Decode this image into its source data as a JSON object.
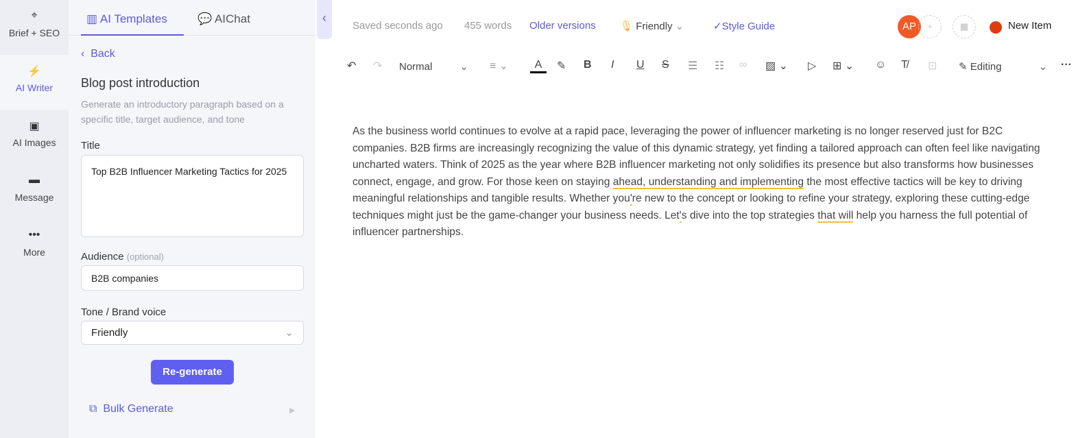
{
  "nav": {
    "items": [
      {
        "label": "Brief + SEO",
        "icon": "crosshair-icon"
      },
      {
        "label": "AI Writer",
        "icon": "lightning-icon"
      },
      {
        "label": "AI Images",
        "icon": "image-icon"
      },
      {
        "label": "Message",
        "icon": "message-icon"
      },
      {
        "label": "More",
        "icon": "more-icon"
      }
    ]
  },
  "panel": {
    "tabs": [
      {
        "label": "AI Templates"
      },
      {
        "label": "AIChat"
      }
    ],
    "back": "Back",
    "template_title": "Blog post introduction",
    "template_desc": "Generate an introductory paragraph based on a specific title, target audience, and tone",
    "title_label": "Title",
    "title_value": "Top B2B Influencer Marketing Tactics for 2025",
    "audience_label": "Audience",
    "audience_optional": "(optional)",
    "audience_value": "B2B companies",
    "tone_label": "Tone / Brand voice",
    "tone_value": "Friendly",
    "regenerate": "Re-generate",
    "bulk_generate": "Bulk Generate"
  },
  "header": {
    "saved": "Saved seconds ago",
    "words": "455 words",
    "older_versions": "Older versions",
    "voice": "Friendly",
    "style_guide": "Style Guide",
    "avatar": "AP",
    "new_item": "New Item",
    "status_color": "#e03a10"
  },
  "toolbar": {
    "style": "Normal",
    "mode": "Editing"
  },
  "editor": {
    "segments": [
      "As the business world continues to evolve at a rapid pace, leveraging the power of influencer marketing is no longer reserved just for B2C companies. B2B firms are increasingly recognizing the value of this dynamic strategy, yet finding a tailored approach can often feel like navigating uncharted waters. Think of 2025 as the year where B2B influencer marketing not only solidifies its presence but also transforms how businesses connect, engage, and grow. For those keen on staying ",
      "ahead, understanding and implementing",
      " the most effective tactics will be key to driving meaningful relationships and tangible results. Whether you",
      "'",
      "re new to the concept or looking to refine your strategy, exploring these cutting-edge techniques might just be the game-changer your business needs. Let",
      "'",
      "s dive into the top strategies ",
      "that will",
      " help you harness the full potential of influencer partnerships."
    ]
  }
}
